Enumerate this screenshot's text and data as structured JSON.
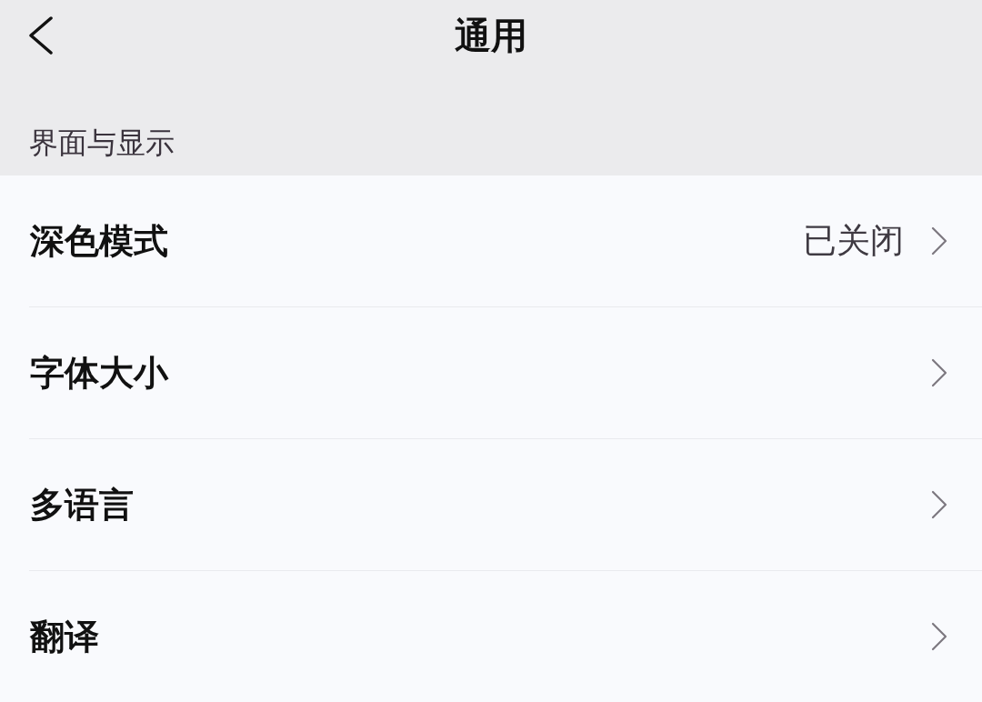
{
  "nav_bar": {
    "title": "通用"
  },
  "section": {
    "label": "界面与显示"
  },
  "rows": [
    {
      "label": "深色模式",
      "value": "已关闭"
    },
    {
      "label": "字体大小"
    },
    {
      "label": "多语言"
    },
    {
      "label": "翻译"
    }
  ]
}
